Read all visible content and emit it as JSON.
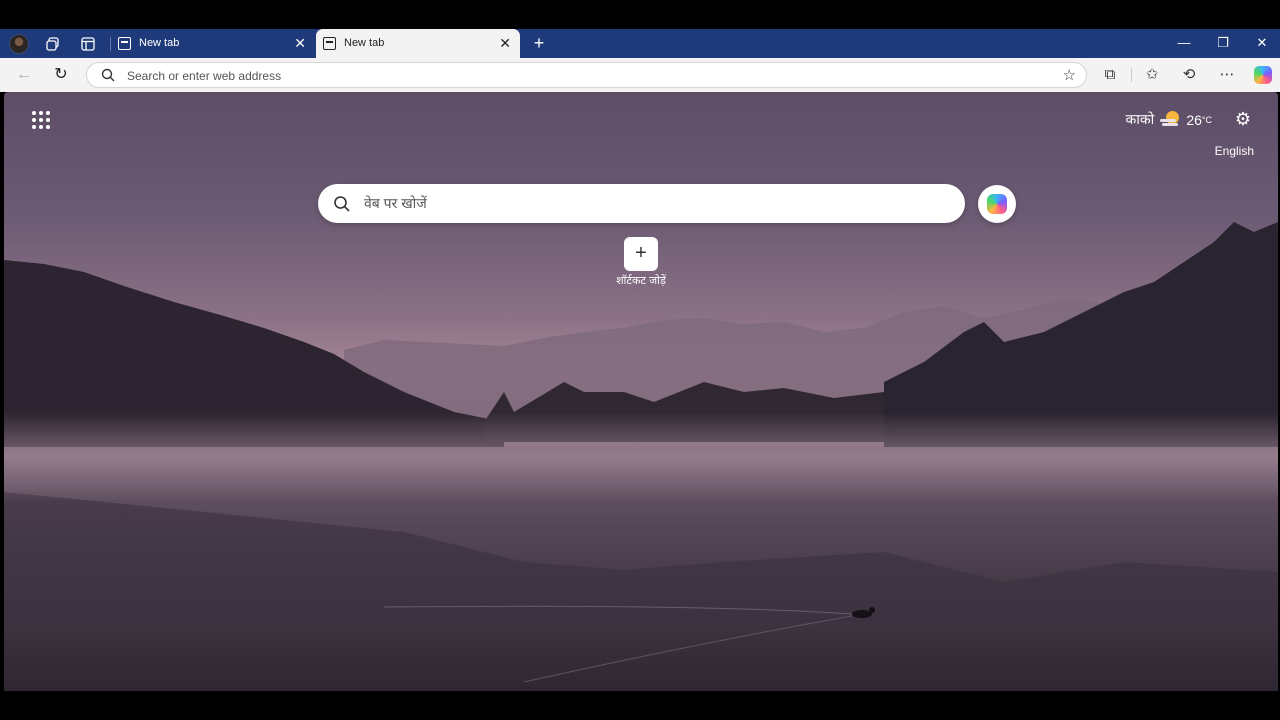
{
  "tabs": [
    {
      "label": "New tab",
      "active": false
    },
    {
      "label": "New tab",
      "active": true
    }
  ],
  "window_controls": {
    "minimize": "—",
    "restore": "❐",
    "close": "✕"
  },
  "address_bar": {
    "placeholder": "Search or enter web address"
  },
  "newtab_page": {
    "weather": {
      "location": "काको",
      "temperature": "26",
      "unit": "°C"
    },
    "language": "English",
    "search_placeholder": "वेब पर खोजें",
    "add_shortcut_label": "शॉर्टकट जोड़ें"
  },
  "icons": {
    "tab_actions": "tab-actions-icon",
    "vertical_tabs": "vertical-tabs-icon",
    "new_tab": "plus-icon",
    "back": "back-arrow-icon",
    "refresh": "refresh-icon",
    "favorite": "star-icon",
    "extensions": "puzzle-icon",
    "favorites": "favorites-icon",
    "history": "history-icon",
    "more": "more-icon",
    "copilot": "copilot-icon",
    "apps": "apps-grid-icon",
    "settings": "gear-icon"
  },
  "colors": {
    "tab_bar": "#1e3a7a",
    "toolbar": "#f3f3f3"
  }
}
